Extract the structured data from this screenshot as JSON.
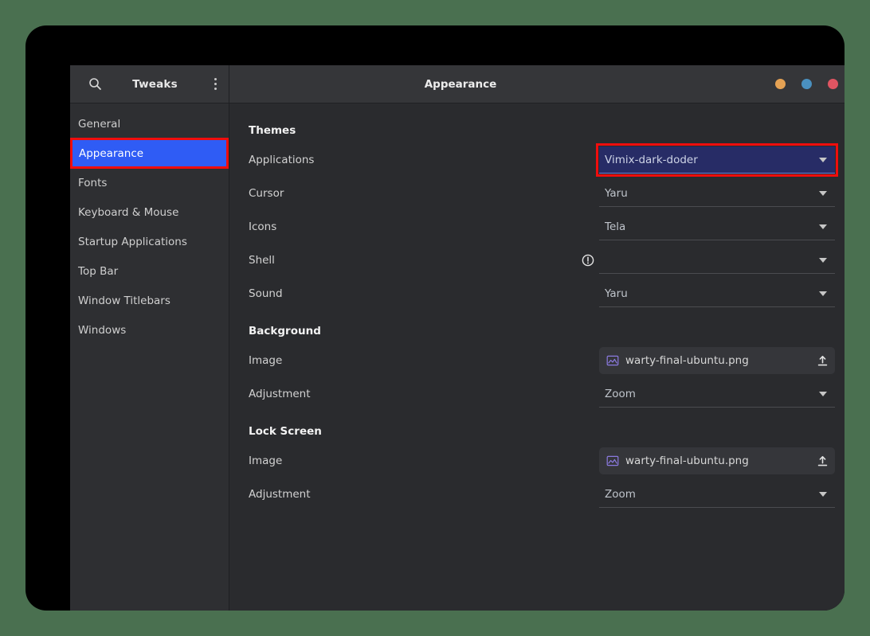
{
  "desktop": {
    "backdrop_color": "#4a7050"
  },
  "window": {
    "frame_color": "#000000",
    "title": "Appearance",
    "app_name": "Tweaks",
    "controls": [
      {
        "name": "minimize",
        "color": "#e5a254"
      },
      {
        "name": "maximize",
        "color": "#4a90bf"
      },
      {
        "name": "close",
        "color": "#e05562"
      }
    ],
    "header_icons": {
      "search": "search-icon",
      "menu": "menu-dots-vertical-icon"
    }
  },
  "sidebar": {
    "items": [
      {
        "label": "General",
        "selected": false
      },
      {
        "label": "Appearance",
        "selected": true
      },
      {
        "label": "Fonts",
        "selected": false
      },
      {
        "label": "Keyboard & Mouse",
        "selected": false
      },
      {
        "label": "Startup Applications",
        "selected": false
      },
      {
        "label": "Top Bar",
        "selected": false
      },
      {
        "label": "Window Titlebars",
        "selected": false
      },
      {
        "label": "Windows",
        "selected": false
      }
    ],
    "selection_color": "#2f5cf5",
    "highlight_border_color": "#f00d0d"
  },
  "content": {
    "sections": [
      {
        "title": "Themes",
        "rows": [
          {
            "label": "Applications",
            "type": "combo",
            "value": "Vimix-dark-doder",
            "highlighted": true,
            "warning": false
          },
          {
            "label": "Cursor",
            "type": "combo",
            "value": "Yaru",
            "highlighted": false,
            "warning": false
          },
          {
            "label": "Icons",
            "type": "combo",
            "value": "Tela",
            "highlighted": false,
            "warning": false
          },
          {
            "label": "Shell",
            "type": "combo",
            "value": "",
            "highlighted": false,
            "warning": true
          },
          {
            "label": "Sound",
            "type": "combo",
            "value": "Yaru",
            "highlighted": false,
            "warning": false
          }
        ]
      },
      {
        "title": "Background",
        "rows": [
          {
            "label": "Image",
            "type": "file",
            "value": "warty-final-ubuntu.png",
            "highlighted": false,
            "warning": false
          },
          {
            "label": "Adjustment",
            "type": "combo",
            "value": "Zoom",
            "highlighted": false,
            "warning": false
          }
        ]
      },
      {
        "title": "Lock Screen",
        "rows": [
          {
            "label": "Image",
            "type": "file",
            "value": "warty-final-ubuntu.png",
            "highlighted": false,
            "warning": false
          },
          {
            "label": "Adjustment",
            "type": "combo",
            "value": "Zoom",
            "highlighted": false,
            "warning": false
          }
        ]
      }
    ],
    "icon_names": {
      "file_preview": "image-file-icon",
      "file_open": "upload-open-icon",
      "warning": "warning-exclamation-icon",
      "dropdown": "chevron-down-icon"
    }
  }
}
